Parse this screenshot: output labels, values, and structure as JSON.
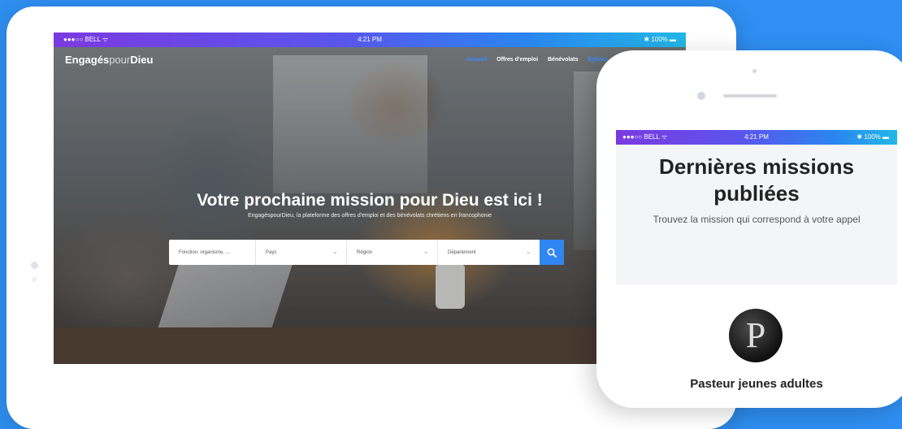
{
  "tablet": {
    "status_bar": {
      "carrier": "●●●○○ BELL ᯤ",
      "time": "4:21 PM",
      "battery": "✱ 100% ▬"
    },
    "logo": {
      "part1": "Engagés",
      "part2": "pour",
      "part3": "Dieu"
    },
    "nav": [
      {
        "label": "Accueil"
      },
      {
        "label": "Offres d'emploi"
      },
      {
        "label": "Bénévolats"
      },
      {
        "label": "Eglises"
      }
    ],
    "hero": {
      "headline": "Votre prochaine mission pour Dieu est ici !",
      "tagline": "EngagéspourDieu, la plateforme des offres d'emploi et des bénévolats chrétiens en francophonie"
    },
    "search": {
      "keyword_placeholder": "Fonction, organisme, ...",
      "country_label": "Pays",
      "region_label": "Région",
      "department_label": "Département",
      "button_icon": "search-icon"
    }
  },
  "phone": {
    "status_bar": {
      "carrier": "●●●○○ BELL ᯤ",
      "time": "4:21 PM",
      "battery": "✱ 100% ▬"
    },
    "title": "Dernières missions publiées",
    "subtitle": "Trouvez la mission qui correspond à votre appel",
    "card": {
      "avatar_letter": "P",
      "job_title": "Pasteur jeunes adultes"
    }
  },
  "colors": {
    "background": "#2f8ff2",
    "accent": "#2f86f2",
    "status_gradient_start": "#7b3ae0",
    "status_gradient_end": "#22b8e8"
  }
}
